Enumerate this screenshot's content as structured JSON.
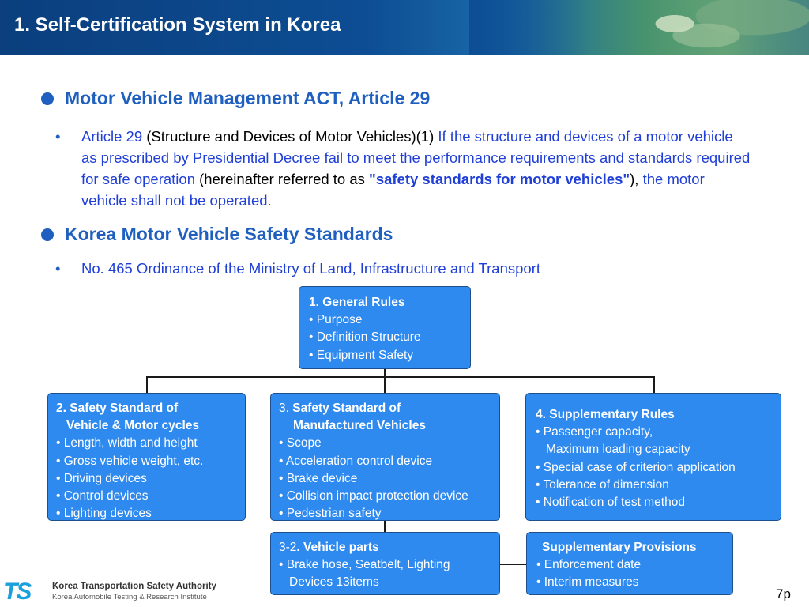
{
  "header": {
    "title": "1. Self-Certification System in Korea"
  },
  "section1": {
    "heading": "Motor Vehicle Management ACT, Article 29",
    "bullet": {
      "p1": "Article 29",
      "p2": " (Structure and Devices of Motor Vehicles)(1) ",
      "p3": "If the structure and devices of a motor vehicle as prescribed by Presidential Decree fail to meet the performance requirements and standards required for safe operation",
      "p4": " (hereinafter referred to as ",
      "p5": "\"safety standards for motor vehicles\"",
      "p6": "), ",
      "p7": "the motor vehicle shall not be operated."
    }
  },
  "section2": {
    "heading": "Korea Motor Vehicle Safety Standards",
    "bullet": "No. 465 Ordinance of the Ministry of Land, Infrastructure and Transport"
  },
  "boxes": {
    "general": {
      "title": "1. General Rules",
      "items": [
        "• Purpose",
        "• Definition Structure",
        "• Equipment Safety"
      ]
    },
    "vehicle": {
      "title1": "2. Safety Standard of",
      "title2": "Vehicle & Motor cycles",
      "items": [
        "• Length, width and height",
        "• Gross vehicle weight, etc.",
        "• Driving devices",
        "• Control devices",
        "• Lighting devices"
      ]
    },
    "manufactured": {
      "num": "3. ",
      "title1": "Safety Standard of",
      "title2": "Manufactured Vehicles",
      "items": [
        "• Scope",
        "• Acceleration control device",
        "• Brake device",
        "• Collision impact protection device",
        "• Pedestrian safety"
      ]
    },
    "supplementary": {
      "title": "4. Supplementary Rules",
      "items": [
        "• Passenger capacity,",
        "Maximum loading capacity",
        "• Special case of criterion application",
        "• Tolerance of dimension",
        "• Notification of test method"
      ]
    },
    "parts": {
      "num": "3-2",
      "title": ". Vehicle parts",
      "items": [
        "• Brake hose, Seatbelt, Lighting",
        "Devices  13items"
      ]
    },
    "provisions": {
      "title": "Supplementary Provisions",
      "items": [
        "• Enforcement date",
        "• Interim measures"
      ]
    }
  },
  "footer": {
    "logo_mark": "TS",
    "logo_line1": "Korea Transportation Safety Authority",
    "logo_line2": "Korea  Automobile Testing &  Research  Institute",
    "page": "7p"
  },
  "colors": {
    "accent": "#1f5fbf",
    "box_fill": "#2f8af0",
    "header": "#0d4d93"
  }
}
